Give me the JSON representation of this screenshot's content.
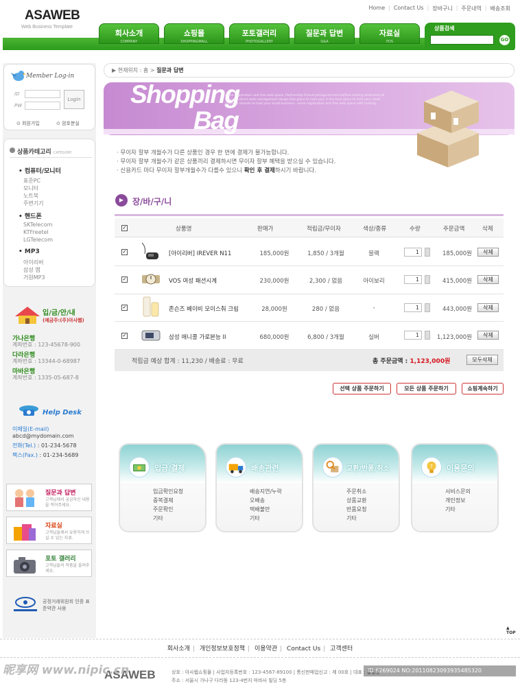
{
  "header": {
    "logo": "ASAWEB",
    "logo_sub": "Web Business Template",
    "top_links": [
      "Home",
      "Contact Us",
      "장바구니",
      "주문내역",
      "배송조회"
    ],
    "nav": [
      {
        "label": "회사소개",
        "sub": "COMPANY"
      },
      {
        "label": "쇼핑몰",
        "sub": "SHOPPINGMALL"
      },
      {
        "label": "포토갤러리",
        "sub": "PHOTOGALLERY"
      },
      {
        "label": "질문과 답변",
        "sub": "Q&A"
      },
      {
        "label": "자료실",
        "sub": "PDS"
      }
    ],
    "search_label": "상품검색",
    "search_go": "GO"
  },
  "login": {
    "title": "Member Log-in",
    "id_label": "ID",
    "pw_label": "PW",
    "button": "Login",
    "join": "회원가입",
    "find": "암호분실"
  },
  "category": {
    "title": "상품카테고리",
    "title_sub": "CATEGORY",
    "groups": [
      {
        "name": "컴퓨터/모니터",
        "items": [
          "표준PC",
          "모니터",
          "노트북",
          "주변기기"
        ]
      },
      {
        "name": "핸드폰",
        "items": [
          "SKTelecom",
          "KTFreetel",
          "LGTelecom"
        ]
      },
      {
        "name": "MP3",
        "items": [
          "아이리버",
          "삼성 옙",
          "거원MP3"
        ]
      }
    ]
  },
  "bank": {
    "title": "입/금/안/내",
    "sub": "(예금주:(주)아사웹)",
    "accounts": [
      {
        "name": "가나은행",
        "num": "계좌번호 : 123-45678-900"
      },
      {
        "name": "다라은행",
        "num": "계좌번호 : 13344-0-68987"
      },
      {
        "name": "마바은행",
        "num": "계좌번호 : 1335-05-687-8"
      }
    ]
  },
  "help": {
    "title": "Help Desk",
    "email_label": "이메일(E-mail)",
    "email": "abcd@mydomain.com",
    "tel_label": "전화(Tel.)",
    "tel": " : 01-234-5678",
    "fax_label": "팩스(Fax.)",
    "fax": " : 01-234-5689"
  },
  "promos": [
    {
      "title": "질문과 답변",
      "desc": "고객님께서 궁금하신 내용을 적어주세요.",
      "color": "#c2185b"
    },
    {
      "title": "자료실",
      "desc": "고객님들께서 유용하게 쓰실 수 있는 자료.",
      "color": "#d84315"
    },
    {
      "title": "포토 갤러리",
      "desc": "고객님들의 작품을 올려주세요.",
      "color": "#2e7d32"
    }
  ],
  "ftc": "공정거래위원회 인증 표준약관 사용",
  "breadcrumb": {
    "prefix": "현재위치 : 홈 > ",
    "current": "질문과 답변"
  },
  "banner": {
    "word1": "Shopping",
    "word2": "Bag",
    "small_text": "some registration and free web space. Partnership Pr/everything/commercial/free hosting dedicated.all free web direct-web management design.free place to hold your in the best place to hold your small business domain to hold your small business - some registration and free web space with hosting."
  },
  "notes": [
    {
      "pre": "· 무이자 할부 개월수가 다른 상품인 경우 한 번에 결제가 불가능합니다.",
      "bold": "",
      "post": ""
    },
    {
      "pre": "· 무이자 할부 개월수가 같은 상품끼리 결제하시면 무이자 할부 혜택을 받으실 수 있습니다.",
      "bold": "",
      "post": ""
    },
    {
      "pre": "· 신용카드 마다 무이자 할부개월수가 다를수 있으니 ",
      "bold": "확인 후 결제",
      "post": "하시기 바랍니다."
    }
  ],
  "cart": {
    "title": "장/바/구/니",
    "headers": [
      "상품명",
      "판매가",
      "적립금/무이자",
      "색상/종류",
      "수량",
      "주문금액",
      "삭제"
    ],
    "rows": [
      {
        "name": "[아이리버] IREVER N11",
        "price": "185,000원",
        "point": "1,850 / 3개월",
        "color": "블랙",
        "qty": "1",
        "amount": "185,000원",
        "del": "삭제"
      },
      {
        "name": "VOS 여성 패션시계",
        "price": "230,000원",
        "point": "2,300 / 없음",
        "color": "아이보리",
        "qty": "1",
        "amount": "415,000원",
        "del": "삭제"
      },
      {
        "name": "존슨즈 베이비 모이스춰 크림",
        "price": "28,000원",
        "point": "280 / 없음",
        "color": "-",
        "qty": "1",
        "amount": "443,000원",
        "del": "삭제"
      },
      {
        "name": "삼성 애니콜 가로본능 II",
        "price": "680,000원",
        "point": "6,800 / 3개월",
        "color": "실버",
        "qty": "1",
        "amount": "1,123,000원",
        "del": "삭제"
      }
    ],
    "summary_left": "적립금 예상 합계 : 11,230   /   배송료 : 무료",
    "total_label": "총 주문금액 : ",
    "total": "1,123,000원",
    "delete_all": "모두삭제",
    "actions": [
      "선택 상품 주문하기",
      "모든 상품 주문하기",
      "쇼핑계속하기"
    ]
  },
  "panels": [
    {
      "title": "입금/결제",
      "items": [
        "입금확인요청",
        "중복결제",
        "주문확인",
        "기타"
      ]
    },
    {
      "title": "배송관련",
      "items": [
        "배송지연/누락",
        "오배송",
        "택배불만",
        "기타"
      ]
    },
    {
      "title": "교환/반품/취소",
      "items": [
        "주문취소",
        "상품교환",
        "반품요청",
        "기타"
      ]
    },
    {
      "title": "이용문의",
      "items": [
        "서비스문의",
        "개인정보",
        "기타"
      ]
    }
  ],
  "footer": {
    "links": [
      "회사소개",
      "개인정보보호정책",
      "이용약관",
      "Contact Us",
      "고객센터"
    ],
    "logo": "ASAWEB",
    "addr1": "상호 : 아사웹쇼핑몰  |  사업자등록번호 : 123-4567-89100  |  통신판매업신고 : 제 00호  |  대표 : 홍길동",
    "addr2": "주소 : 서울시 가나구 다라동 123-4번지 마바사 빌딩 5층",
    "top": "TOP",
    "watermark": "昵享网 www.nipic.cn",
    "watermark_id": "ID:6269024 NO:20110823093935485320"
  }
}
